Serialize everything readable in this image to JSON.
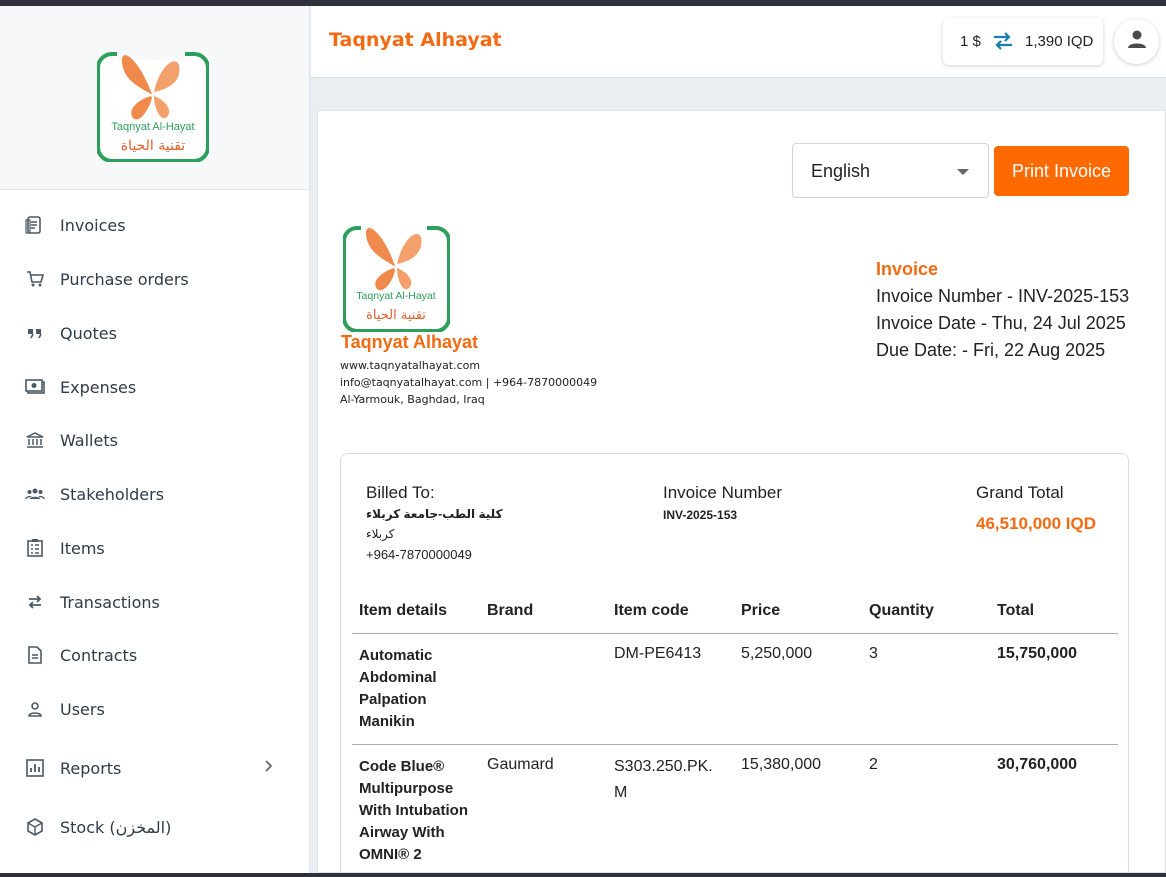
{
  "logo": {
    "text_en": "Taqnyat Al-Hayat",
    "text_ar": "تقنية الحياة"
  },
  "sidebar": {
    "items": [
      {
        "label": "Invoices",
        "icon": "invoice-icon"
      },
      {
        "label": "Purchase orders",
        "icon": "cart-icon"
      },
      {
        "label": "Quotes",
        "icon": "quote-icon"
      },
      {
        "label": "Expenses",
        "icon": "expenses-icon"
      },
      {
        "label": "Wallets",
        "icon": "bank-icon"
      },
      {
        "label": "Stakeholders",
        "icon": "group-icon"
      },
      {
        "label": "Items",
        "icon": "checklist-icon"
      },
      {
        "label": "Transactions",
        "icon": "swap-icon"
      },
      {
        "label": "Contracts",
        "icon": "document-icon"
      },
      {
        "label": "Users",
        "icon": "user-icon"
      },
      {
        "label": "Reports",
        "icon": "chart-icon"
      },
      {
        "label": "Stock (المخزن)",
        "icon": "box-icon"
      }
    ]
  },
  "header": {
    "title": "Taqnyat Alhayat",
    "rate_usd": "1 $",
    "rate_iqd": "1,390 IQD"
  },
  "toolbar": {
    "language": "English",
    "print_label": "Print Invoice"
  },
  "company": {
    "name": "Taqnyat Alhayat",
    "website": "www.taqnyatalhayat.com",
    "contact": "info@taqnyatalhayat.com | +964-7870000049",
    "address": "Al-Yarmouk, Baghdad, Iraq"
  },
  "invoice": {
    "title": "Invoice",
    "number_line": "Invoice Number - INV-2025-153",
    "date_line": "Invoice Date - Thu, 24 Jul 2025",
    "due_line": "Due Date: - Fri, 22 Aug 2025"
  },
  "billing": {
    "billed_to_label": "Billed To:",
    "client_name": "كلية الطب-جامعة كربلاء",
    "client_city": "كربلاء",
    "client_phone": "+964-7870000049",
    "invoice_number_label": "Invoice Number",
    "invoice_number": "INV-2025-153",
    "grand_total_label": "Grand Total",
    "grand_total": "46,510,000 IQD"
  },
  "table": {
    "headers": [
      "Item details",
      "Brand",
      "Item code",
      "Price",
      "Quantity",
      "Total"
    ],
    "rows": [
      {
        "name_lines": [
          "Automatic",
          "Abdominal",
          "Palpation",
          "Manikin"
        ],
        "brand": "",
        "code_lines": [
          "DM-PE6413"
        ],
        "price": "5,250,000",
        "quantity": "3",
        "total": "15,750,000"
      },
      {
        "name_lines": [
          "Code Blue®",
          "Multipurpose",
          "With Intubation",
          "Airway With",
          "OMNI® 2"
        ],
        "brand": "Gaumard",
        "code_lines": [
          "S303.250.PK.",
          "M"
        ],
        "price": "15,380,000",
        "quantity": "2",
        "total": "30,760,000"
      }
    ]
  },
  "colors": {
    "accent": "#f26a12",
    "button": "#ff6a00",
    "logo_green": "#2e9e5b",
    "logo_orange": "#ef8a4c"
  }
}
